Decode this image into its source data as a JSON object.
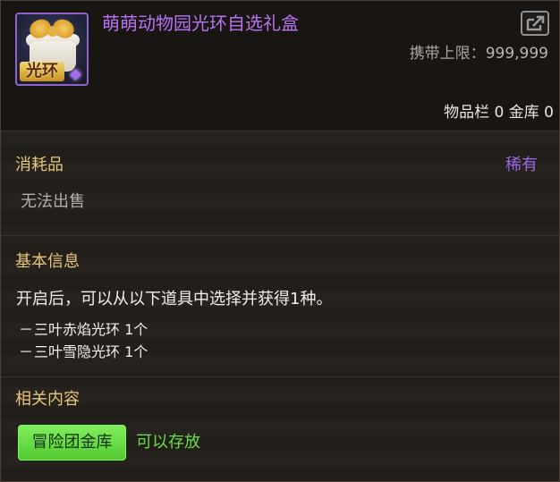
{
  "item": {
    "title": "萌萌动物园光环自选礼盒",
    "icon_badge": "光环",
    "icon": "gift-box-icon",
    "carry_limit_label": "携带上限：",
    "carry_limit_value": "999,999",
    "storage_counts": "物品栏 0 金库 0"
  },
  "category": {
    "label": "消耗品",
    "rarity": "稀有",
    "sell_status": "无法出售"
  },
  "basic_info": {
    "label": "基本信息",
    "description": "开启后，可以从以下道具中选择并获得1种。",
    "choices": [
      "三叶赤焰光环 1个",
      "三叶雪隐光环 1个"
    ],
    "choice_dash": "－"
  },
  "related": {
    "label": "相关内容",
    "button_label": "冒险团金库",
    "status": "可以存放"
  },
  "colors": {
    "title": "#b774f2",
    "section": "#e8c67b",
    "rarity": "#9d67e8",
    "accent_green": "#67df44"
  },
  "icons": {
    "share": "share-icon"
  }
}
